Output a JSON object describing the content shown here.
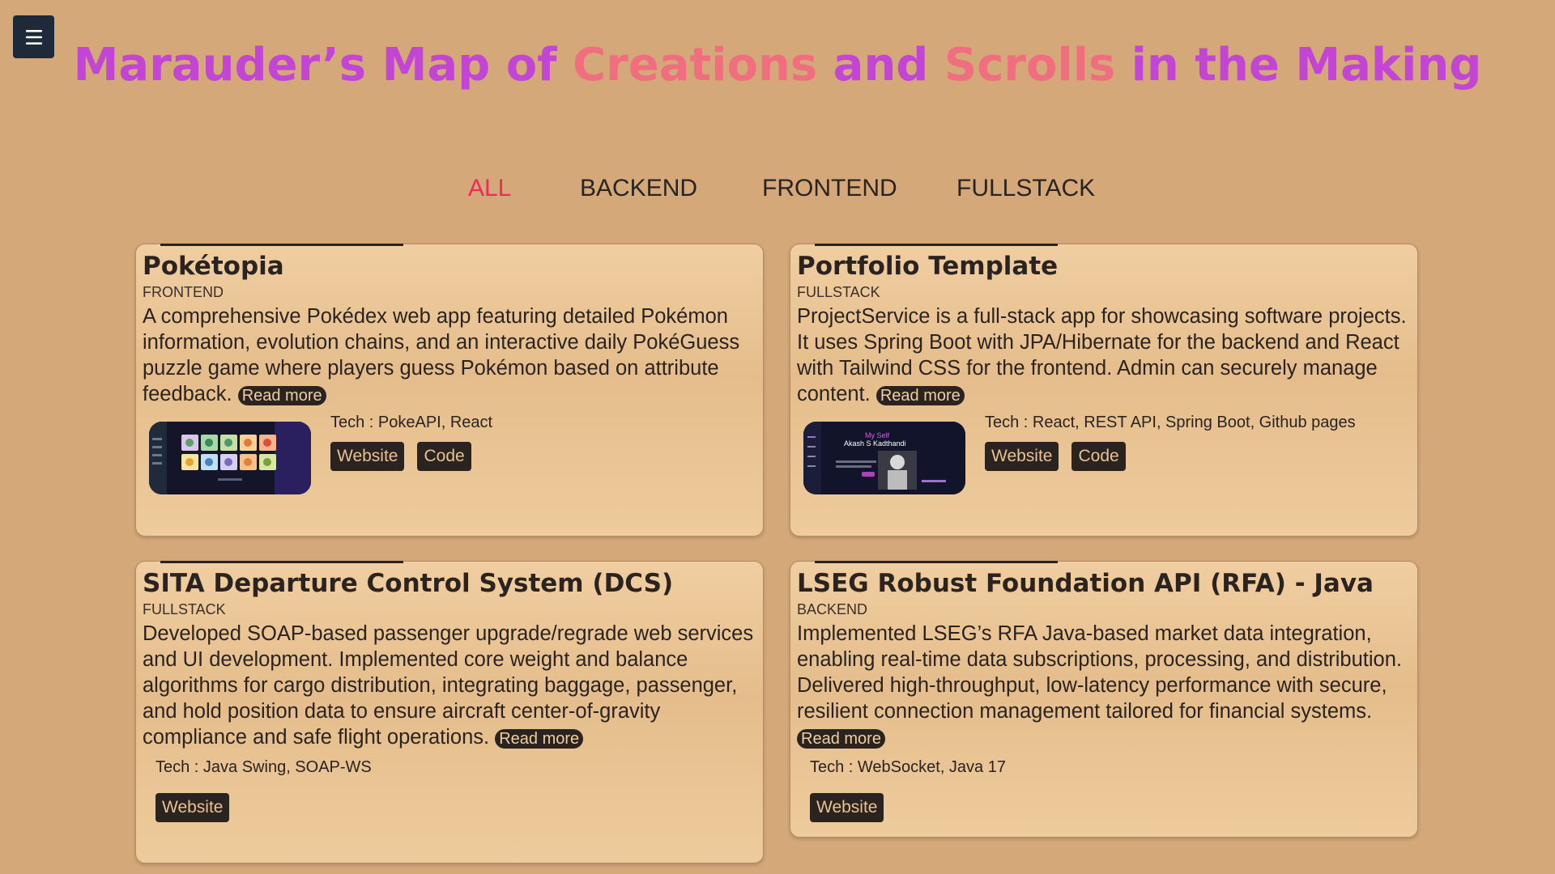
{
  "header": {
    "title_parts": [
      "Marauder’s Map of ",
      "Creations",
      " and ",
      "Scrolls",
      " in the Making"
    ],
    "colors": {
      "primary": "#c245d6",
      "secondary": "#f06e80"
    }
  },
  "menu": {
    "icon": "hamburger-icon"
  },
  "filters": [
    {
      "label": "ALL",
      "active": true
    },
    {
      "label": "BACKEND",
      "active": false
    },
    {
      "label": "FRONTEND",
      "active": false
    },
    {
      "label": "FULLSTACK",
      "active": false
    }
  ],
  "projects": [
    {
      "title": "Pokétopia",
      "category": "FRONTEND",
      "description": "A comprehensive Pokédex web app featuring detailed Pokémon information, evolution chains, and an interactive daily PokéGuess puzzle game where players guess Pokémon based on attribute feedback.",
      "read_more": "Read more",
      "tech": "Tech : PokeAPI, React",
      "buttons": [
        "Website",
        "Code"
      ],
      "thumbnail": "pokemon-grid"
    },
    {
      "title": "Portfolio Template",
      "category": "FULLSTACK",
      "description": "ProjectService is a full-stack app for showcasing software projects. It uses Spring Boot with JPA/Hibernate for the backend and React with Tailwind CSS for the frontend. Admin can securely manage content.",
      "read_more": "Read more",
      "tech": "Tech : React, REST API, Spring Boot, Github pages",
      "buttons": [
        "Website",
        "Code"
      ],
      "thumbnail": "portfolio-dark"
    },
    {
      "title": "SITA Departure Control System (DCS)",
      "category": "FULLSTACK",
      "description": "Developed SOAP-based passenger upgrade/regrade web services and UI development. Implemented core weight and balance algorithms for cargo distribution, integrating baggage, passenger, and hold position data to ensure aircraft center-of-gravity compliance and safe flight operations.",
      "read_more": "Read more",
      "tech": "Tech : Java Swing, SOAP-WS",
      "buttons": [
        "Website"
      ],
      "thumbnail": ""
    },
    {
      "title": "LSEG Robust Foundation API (RFA) - Java",
      "category": "BACKEND",
      "description": "Implemented LSEG’s RFA Java-based market data integration, enabling real-time data subscriptions, processing, and distribution. Delivered high-throughput, low-latency performance with secure, resilient connection management tailored for financial systems.",
      "read_more": "Read more",
      "tech": "Tech : WebSocket, Java 17",
      "buttons": [
        "Website"
      ],
      "thumbnail": ""
    }
  ],
  "thumb_text": {
    "portfolio_name_line1": "My Self",
    "portfolio_name_line2": "Akash S Kadthandi"
  }
}
